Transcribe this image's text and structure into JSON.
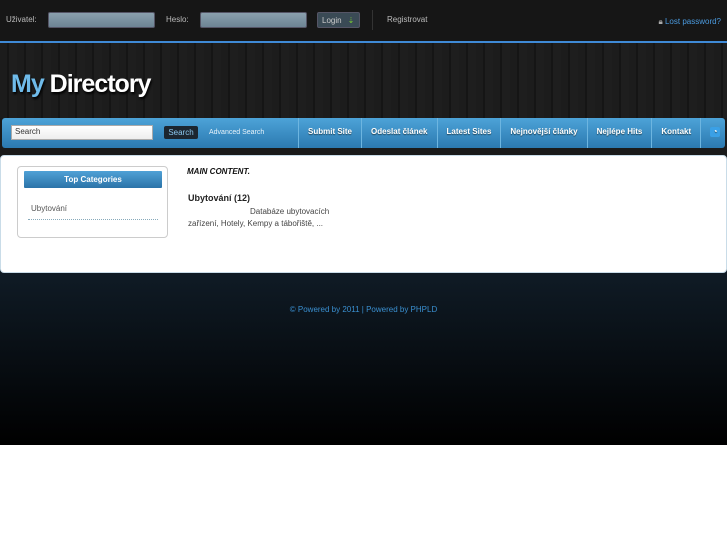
{
  "topbar": {
    "user_label": "Uživatel:",
    "pass_label": "Heslo:",
    "login_label": "Login",
    "register_label": "Registrovat",
    "lost_password": "Lost password?"
  },
  "header": {
    "logo_my": "My",
    "logo_rest": " Directory"
  },
  "nav": {
    "search_placeholder": "Search",
    "search_button": "Search",
    "advanced_search": "Advanced Search",
    "items": [
      {
        "label": "Submit Site"
      },
      {
        "label": "Odeslat článek"
      },
      {
        "label": "Latest Sites"
      },
      {
        "label": "Nejnovější články"
      },
      {
        "label": "Nejlépe Hits"
      },
      {
        "label": "Kontakt"
      }
    ]
  },
  "sidebar": {
    "title": "Top Categories",
    "items": [
      {
        "label": "Ubytování"
      }
    ]
  },
  "main": {
    "heading": "MAIN CONTENT.",
    "category_title": "Ubytování (12)",
    "category_desc": "Databáze ubytovacích zařízení, Hotely, Kempy a tábořiště, ..."
  },
  "footer": {
    "text": "© Powered by 2011 | Powered by PHPLD"
  },
  "colors": {
    "accent": "#3f8ad6",
    "link": "#4b9be0"
  }
}
